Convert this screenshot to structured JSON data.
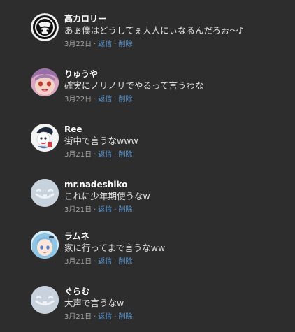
{
  "comments": [
    {
      "author": "高カロリー",
      "text": "あぁ僕はどうしてぇ大人にぃなるんだろぉ～♪",
      "date": "3月22日",
      "reply_label": "返信",
      "delete_label": "削除",
      "avatar_icon": "black-circle-logo-avatar"
    },
    {
      "author": "りゅうや",
      "text": "確実にノリノリでやるって言うわな",
      "date": "3月22日",
      "reply_label": "返信",
      "delete_label": "削除",
      "avatar_icon": "anime-face-avatar"
    },
    {
      "author": "Ree",
      "text": "街中で言うなwww",
      "date": "3月21日",
      "reply_label": "返信",
      "delete_label": "削除",
      "avatar_icon": "cartoon-character-avatar"
    },
    {
      "author": "mr.nadeshiko",
      "text": "これに少年期使うなw",
      "date": "3月21日",
      "reply_label": "返信",
      "delete_label": "削除",
      "avatar_icon": "default-avatar"
    },
    {
      "author": "ラムネ",
      "text": "家に行ってまで言うなww",
      "date": "3月21日",
      "reply_label": "返信",
      "delete_label": "削除",
      "avatar_icon": "anime-girl-avatar"
    },
    {
      "author": "ぐらむ",
      "text": "大声で言うなw",
      "date": "3月21日",
      "reply_label": "返信",
      "delete_label": "削除",
      "avatar_icon": "default-avatar"
    }
  ],
  "colors": {
    "background": "#2d2d2d",
    "link": "#5d9bd9",
    "meta": "#a4a4a4",
    "author": "#ffffff"
  }
}
